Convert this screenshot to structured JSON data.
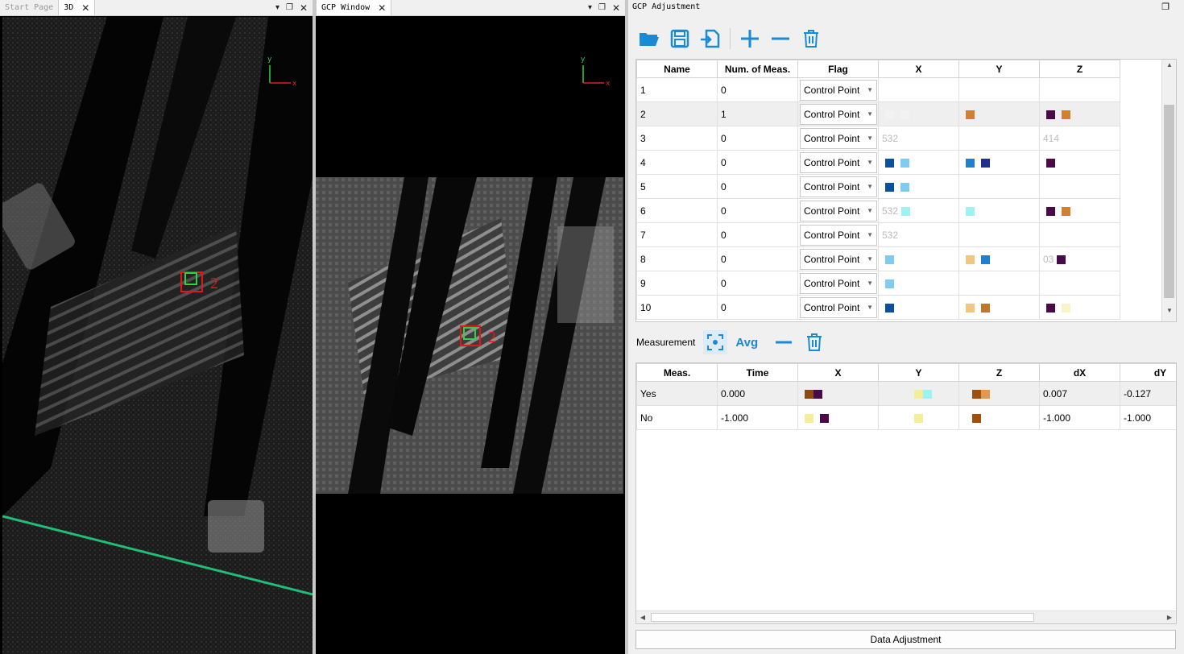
{
  "left_pane": {
    "tabs": [
      {
        "label": "Start Page",
        "active": false
      },
      {
        "label": "3D",
        "active": true
      }
    ],
    "marker_label": "2",
    "axis": {
      "y": "y",
      "x": "x"
    }
  },
  "middle_pane": {
    "tabs": [
      {
        "label": "GCP Window",
        "active": true
      }
    ],
    "marker_label": "2",
    "axis": {
      "y": "y",
      "x": "x"
    }
  },
  "panel": {
    "title": "GCP Adjustment",
    "toolbar": [
      "open-folder-icon",
      "save-icon",
      "import-icon",
      "add-icon",
      "remove-icon",
      "delete-icon"
    ],
    "gcp_table": {
      "headers": [
        "Name",
        "Num. of Meas.",
        "Flag",
        "X",
        "Y",
        "Z"
      ],
      "rows": [
        {
          "name": "1",
          "meas": "0",
          "flag": "Control Point",
          "x": "",
          "y": "",
          "z": ""
        },
        {
          "name": "2",
          "meas": "1",
          "flag": "Control Point",
          "x": "",
          "y": "",
          "z": ""
        },
        {
          "name": "3",
          "meas": "0",
          "flag": "Control Point",
          "x": "532",
          "y": "",
          "z": "414"
        },
        {
          "name": "4",
          "meas": "0",
          "flag": "Control Point",
          "x": "",
          "y": "",
          "z": ""
        },
        {
          "name": "5",
          "meas": "0",
          "flag": "Control Point",
          "x": "",
          "y": "",
          "z": ""
        },
        {
          "name": "6",
          "meas": "0",
          "flag": "Control Point",
          "x": "532",
          "y": "",
          "z": ""
        },
        {
          "name": "7",
          "meas": "0",
          "flag": "Control Point",
          "x": "532",
          "y": "",
          "z": ""
        },
        {
          "name": "8",
          "meas": "0",
          "flag": "Control Point",
          "x": "",
          "y": "",
          "z": "03"
        },
        {
          "name": "9",
          "meas": "0",
          "flag": "Control Point",
          "x": "",
          "y": "",
          "z": ""
        },
        {
          "name": "10",
          "meas": "0",
          "flag": "Control Point",
          "x": "",
          "y": "",
          "z": ""
        }
      ]
    },
    "measurement": {
      "label": "Measurement",
      "avg_label": "Avg",
      "headers": [
        "Meas.",
        "Time",
        "X",
        "Y",
        "Z",
        "dX",
        "dY"
      ],
      "rows": [
        {
          "meas": "Yes",
          "time": "0.000",
          "x": "",
          "y": "",
          "z": "",
          "dx": "0.007",
          "dy": "-0.127"
        },
        {
          "meas": "No",
          "time": "-1.000",
          "x": "",
          "y": "",
          "z": "",
          "dx": "-1.000",
          "dy": "-1.000"
        }
      ]
    },
    "data_adjustment_label": "Data Adjustment",
    "colors": {
      "accent": "#1a8ad4",
      "marker_red": "#e01818",
      "marker_green": "#2fd04a",
      "line_green": "#1fbf7a"
    }
  }
}
